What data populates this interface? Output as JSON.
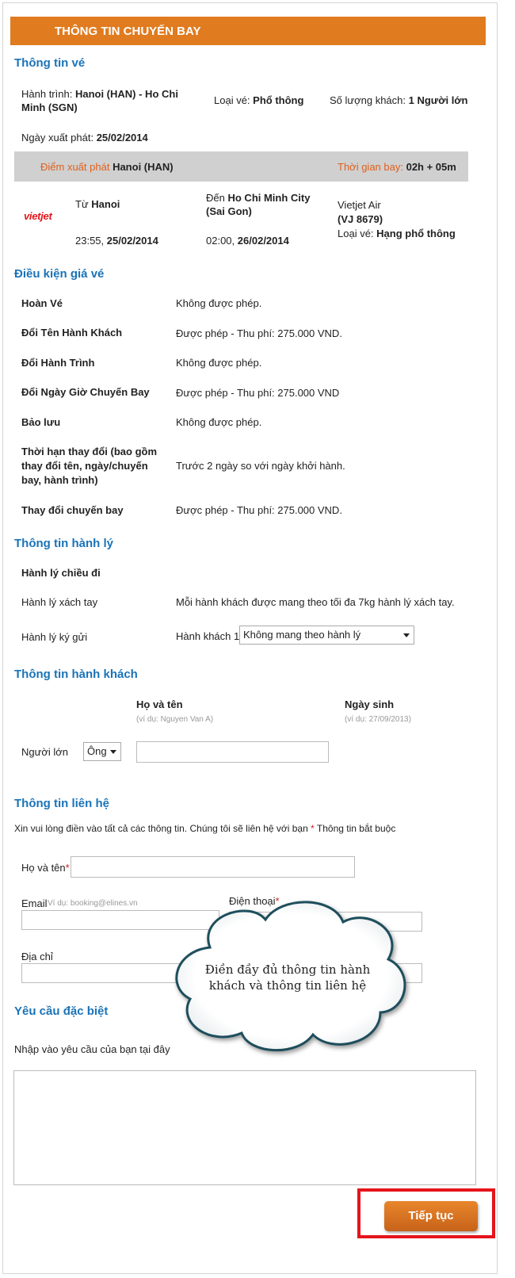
{
  "header": {
    "title": "THÔNG TIN CHUYẾN BAY"
  },
  "ticket": {
    "section_title": "Thông tin vé",
    "route_label": "Hành trình:",
    "route_value_line1": "Hanoi (HAN) - Ho Chi",
    "route_value_line2": "Minh (SGN)",
    "type_label": "Loại vé:",
    "type_value": "Phổ thông",
    "pax_label": "Số lượng khách:",
    "pax_value": "1 Người lớn",
    "date_label": "Ngày xuất phát:",
    "date_value": "25/02/2014",
    "origin_label": "Điểm xuất phát",
    "origin_value": "Hanoi (HAN)",
    "duration_label": "Thời gian bay:",
    "duration_value": "02h + 05m"
  },
  "flight": {
    "airline_logo": "vietjet",
    "from_label": "Từ",
    "from_city": "Hanoi",
    "depart_time": "23:55,",
    "depart_date": "25/02/2014",
    "to_label": "Đến",
    "to_city_line1": "Ho Chi Minh City",
    "to_city_line2": "(Sai Gon)",
    "arrive_time": "02:00,",
    "arrive_date": "26/02/2014",
    "airline": "Vietjet Air",
    "flight_no": "(VJ 8679)",
    "class_label": "Loại vé:",
    "class_value": "Hạng phổ thông"
  },
  "fare_conditions": {
    "section_title": "Điều kiện giá vé",
    "rows": [
      {
        "label": "Hoàn Vé",
        "value": "Không được phép."
      },
      {
        "label": "Đổi Tên Hành Khách",
        "value": "Được phép - Thu phí: 275.000 VND."
      },
      {
        "label": "Đổi Hành Trình",
        "value": "Không được phép."
      },
      {
        "label": "Đổi Ngày Giờ Chuyến Bay",
        "value": "Được phép - Thu phí: 275.000 VND"
      },
      {
        "label": "Bảo lưu",
        "value": "Không được phép."
      },
      {
        "label_lines": [
          "Thời hạn thay đổi (bao gồm",
          "thay đổi tên, ngày/chuyến",
          "bay, hành trình)"
        ],
        "value": "Trước 2 ngày so với ngày khởi hành."
      },
      {
        "label": "Thay đổi chuyến bay",
        "value": "Được phép - Thu phí: 275.000 VND."
      }
    ]
  },
  "baggage": {
    "section_title": "Thông tin hành lý",
    "subtitle": "Hành lý chiều đi",
    "carry_label": "Hành lý xách tay",
    "carry_value": "Mỗi hành khách được mang theo tối đa 7kg hành lý xách tay.",
    "checked_label": "Hành lý ký gửi",
    "passenger_label": "Hành khách 1",
    "checked_select": "Không mang theo hành lý"
  },
  "passengers": {
    "section_title": "Thông tin hành khách",
    "name_header": "Họ và tên",
    "name_hint": "(ví dụ: Nguyen Van A)",
    "dob_header": "Ngày sinh",
    "dob_hint": "(ví dụ: 27/09/2013)",
    "row_label": "Người lớn",
    "title_select": "Ông",
    "name_value": ""
  },
  "contact": {
    "section_title": "Thông tin liên hệ",
    "intro": "Xin vui lòng điền vào tất cả các thông tin. Chúng tôi sẽ liên hệ với bạn",
    "required_mark": "*",
    "required_text": "Thông tin bắt buộc",
    "name_label": "Họ và tên",
    "email_label": "Email",
    "email_placeholder": "Ví dụ: booking@elines.vn",
    "phone_label": "Điện thoại",
    "address_label": "Địa chỉ"
  },
  "callout": {
    "line1": "Điền đầy đủ thông tin hành",
    "line2": "khách và thông tin liên hệ"
  },
  "special": {
    "section_title": "Yêu cầu đặc biệt",
    "prompt": "Nhập vào yêu cầu của bạn tại đây",
    "value": ""
  },
  "actions": {
    "continue_label": "Tiếp tục"
  },
  "colors": {
    "accent": "#e07b1f",
    "section_blue": "#1a73b8",
    "highlight_red": "#e5141b"
  }
}
